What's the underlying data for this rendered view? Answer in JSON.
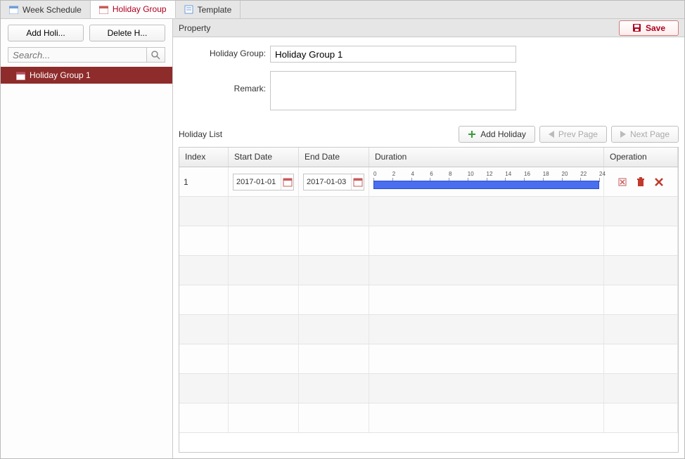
{
  "tabs": [
    {
      "label": "Week Schedule",
      "active": false,
      "icon": "calendar-icon"
    },
    {
      "label": "Holiday Group",
      "active": true,
      "icon": "calendar-icon"
    },
    {
      "label": "Template",
      "active": false,
      "icon": "template-icon"
    }
  ],
  "left": {
    "add_label": "Add Holi...",
    "delete_label": "Delete H...",
    "search_placeholder": "Search...",
    "items": [
      {
        "label": "Holiday Group 1",
        "selected": true
      }
    ]
  },
  "property": {
    "header": "Property",
    "save_label": "Save",
    "fields": {
      "group_label": "Holiday Group:",
      "group_value": "Holiday Group 1",
      "remark_label": "Remark:",
      "remark_value": ""
    }
  },
  "holiday_list": {
    "title": "Holiday List",
    "add_label": "Add Holiday",
    "prev_label": "Prev Page",
    "next_label": "Next Page",
    "columns": {
      "index": "Index",
      "start": "Start Date",
      "end": "End Date",
      "duration": "Duration",
      "operation": "Operation"
    },
    "ticks": [
      "0",
      "2",
      "4",
      "6",
      "8",
      "10",
      "12",
      "14",
      "16",
      "18",
      "20",
      "22",
      "24"
    ],
    "rows": [
      {
        "index": "1",
        "start": "2017-01-01",
        "end": "2017-01-03",
        "bar_start_pct": 0,
        "bar_end_pct": 100
      }
    ],
    "empty_row_count": 8
  }
}
